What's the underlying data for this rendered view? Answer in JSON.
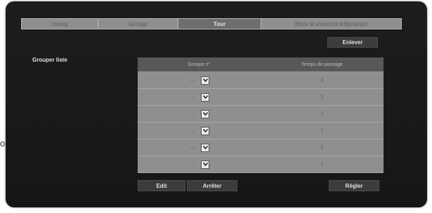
{
  "tabs": [
    {
      "label": "Inserg"
    },
    {
      "label": "Groupp"
    },
    {
      "label": "Tour"
    },
    {
      "label": "Etrck la vmoscmt lettpmaripe"
    }
  ],
  "side_label": "Grouper liste",
  "buttons": {
    "remove": "Enlever",
    "edit": "Edit",
    "stop": "Arrêter",
    "apply": "Régler"
  },
  "table": {
    "headers": [
      "Groupe n°",
      "Temps de passage"
    ],
    "rows": [
      {
        "group": "---",
        "time": "3"
      },
      {
        "group": "---",
        "time": "1"
      },
      {
        "group": "---",
        "time": "3"
      },
      {
        "group": "---",
        "time": "1"
      },
      {
        "group": "---",
        "time": "3"
      },
      {
        "group": "---",
        "time": "1"
      }
    ]
  },
  "edge_glyph": "o",
  "colors": {
    "panel_bg": "#1a1a1a",
    "tab_bar": "#8e8e8e",
    "tab_active": "#6d6d6d",
    "table_header": "#585858",
    "table_row": "#8f8f8f",
    "button_bg": "#3c3c3c"
  }
}
